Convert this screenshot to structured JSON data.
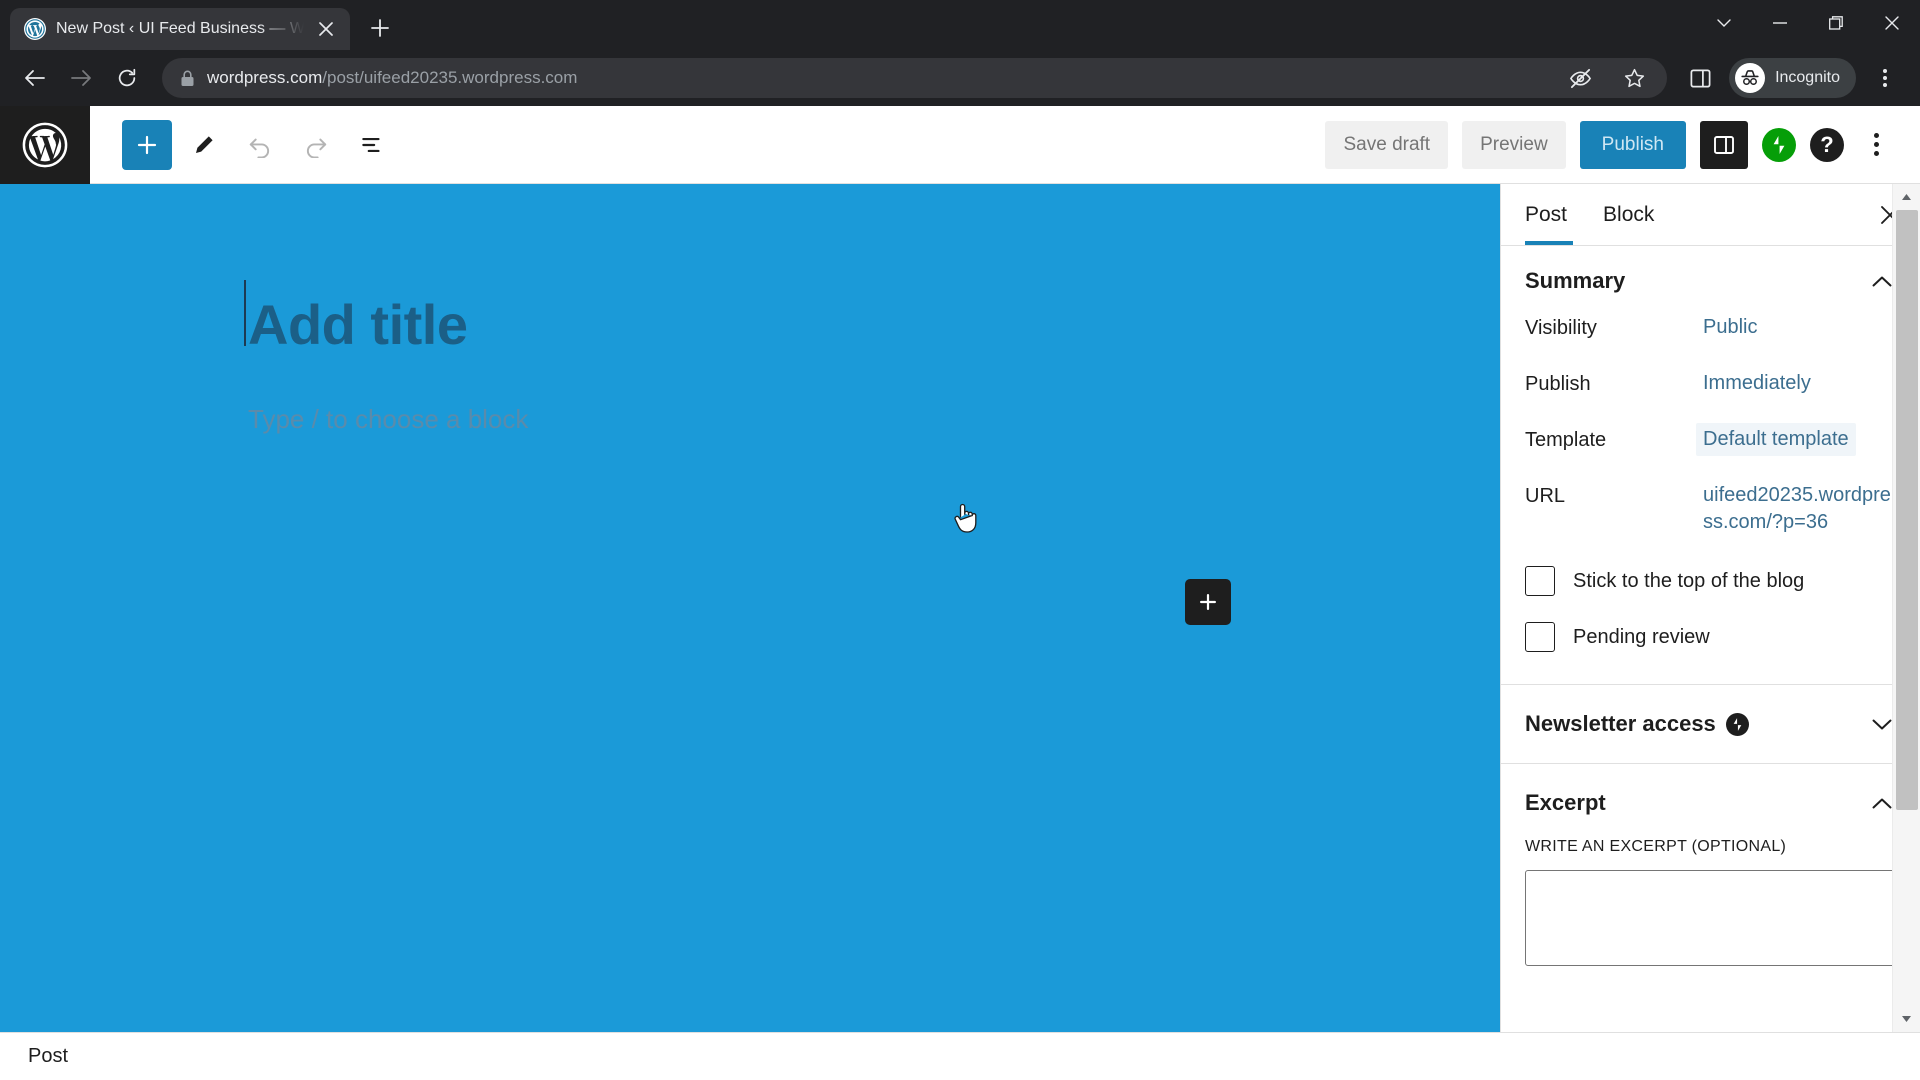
{
  "browser": {
    "tab": {
      "title": "New Post ‹ UI Feed Business — W",
      "favicon": "wordpress-icon",
      "close": "close-icon"
    },
    "new_tab_label": "+",
    "window_controls": [
      "tab-search-chevron-icon",
      "minimize-icon",
      "maximize-icon",
      "close-window-icon"
    ],
    "nav": {
      "back": "back-arrow-icon",
      "forward": "forward-arrow-icon",
      "reload": "reload-icon"
    },
    "omnibox": {
      "lock": "lock-icon",
      "url_domain": "wordpress.com",
      "url_path": "/post/uifeed20235.wordpress.com",
      "full_url": "wordpress.com/post/uifeed20235.wordpress.com"
    },
    "toolbar_icons": [
      "tracking-protection-eye-off-icon",
      "bookmark-star-icon",
      "side-panel-icon"
    ],
    "incognito_label": "Incognito",
    "menu": "browser-menu-kebab-icon"
  },
  "editor": {
    "logo": "wordpress-logo-icon",
    "left_tools": [
      {
        "name": "add-block-button",
        "icon": "plus-icon"
      },
      {
        "name": "edit-tool-button",
        "icon": "pencil-icon"
      },
      {
        "name": "undo-button",
        "icon": "undo-icon"
      },
      {
        "name": "redo-button",
        "icon": "redo-icon"
      },
      {
        "name": "document-overview-button",
        "icon": "list-view-icon"
      }
    ],
    "save_draft_label": "Save draft",
    "preview_label": "Preview",
    "publish_label": "Publish",
    "settings_toggle": "settings-sidebar-icon",
    "jetpack": "jetpack-icon",
    "help": "help-icon",
    "options": "editor-options-kebab-icon",
    "accent_blue": "#1982b7",
    "canvas_bg": "#1b9ad8"
  },
  "canvas": {
    "title_placeholder": "Add title",
    "block_placeholder": "Type / to choose a block",
    "inserter_icon": "plus-icon",
    "cursor": "pointer-hand-cursor"
  },
  "sidebar": {
    "tabs": [
      {
        "label": "Post",
        "active": true
      },
      {
        "label": "Block",
        "active": false
      }
    ],
    "close_icon": "close-icon",
    "panels": {
      "summary": {
        "title": "Summary",
        "expanded": true,
        "chevron": "chevron-up-icon",
        "rows": [
          {
            "label": "Visibility",
            "value": "Public",
            "highlighted": false
          },
          {
            "label": "Publish",
            "value": "Immediately",
            "highlighted": false
          },
          {
            "label": "Template",
            "value": "Default template",
            "highlighted": true
          },
          {
            "label": "URL",
            "value": "uifeed20235.wordpress.com/?p=36",
            "highlighted": false
          }
        ],
        "checkboxes": [
          {
            "label": "Stick to the top of the blog",
            "checked": false
          },
          {
            "label": "Pending review",
            "checked": false
          }
        ]
      },
      "newsletter": {
        "title": "Newsletter access",
        "expanded": false,
        "chevron": "chevron-down-icon",
        "badge": "jetpack-icon"
      },
      "excerpt": {
        "title": "Excerpt",
        "expanded": true,
        "chevron": "chevron-up-icon",
        "field_label": "WRITE AN EXCERPT (OPTIONAL)",
        "field_value": "",
        "field_placeholder": ""
      }
    }
  },
  "status_bar": {
    "text": "Post"
  }
}
